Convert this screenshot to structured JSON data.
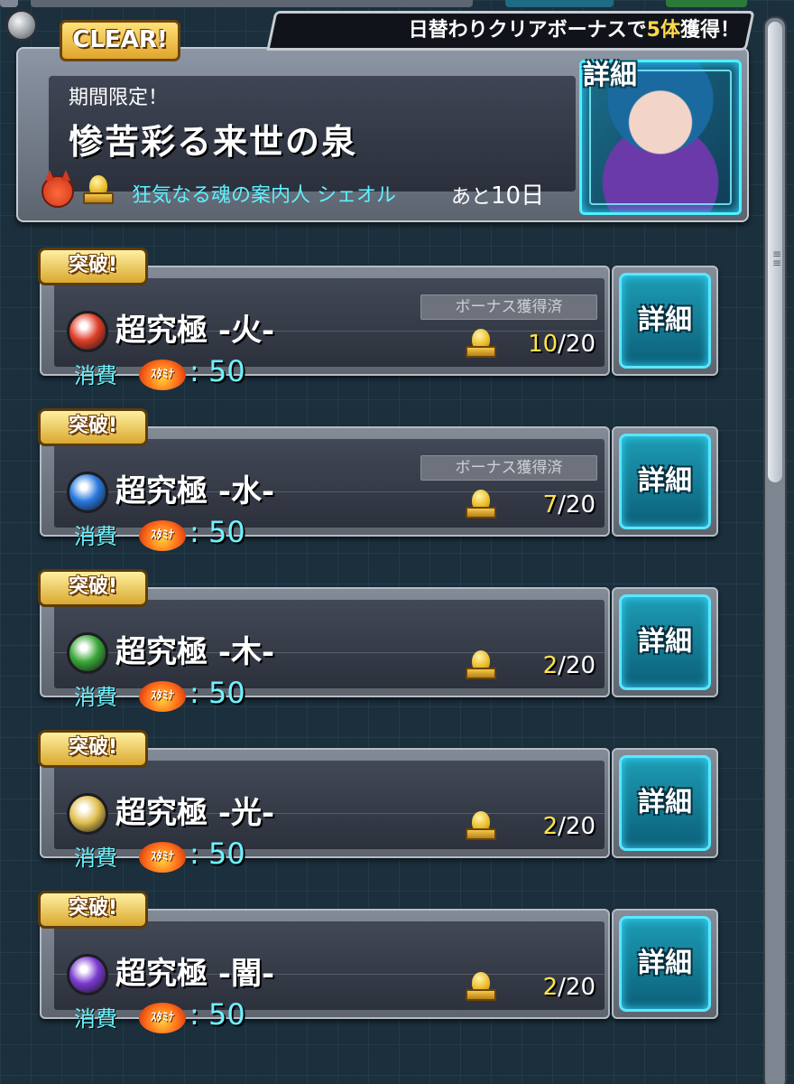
{
  "event": {
    "badge": "CLEAR!",
    "bonus_prefix": "日替わりクリアボーナスで",
    "bonus_count": "5体",
    "bonus_suffix": "獲得！",
    "subtitle": "期間限定！",
    "title": "惨苦彩る来世の泉",
    "guide": "狂気なる魂の案内人 シェオル",
    "remaining_prefix": "あと",
    "remaining_value": "10日",
    "detail_label": "詳細"
  },
  "quests": [
    {
      "breakthrough": "突破!",
      "title": "超究極 -火-",
      "element": "fire",
      "element_color": "#e0402a",
      "bonus_status": "ボーナス獲得済",
      "count_current": "10",
      "count_total": "/20",
      "cost_label": "消費",
      "stamina_label": "ｽﾀﾐﾅ",
      "stamina_value": ": 50",
      "detail_label": "詳細"
    },
    {
      "breakthrough": "突破!",
      "title": "超究極 -水-",
      "element": "water",
      "element_color": "#2a7ae0",
      "bonus_status": "ボーナス獲得済",
      "count_current": "7",
      "count_total": "/20",
      "cost_label": "消費",
      "stamina_label": "ｽﾀﾐﾅ",
      "stamina_value": ": 50",
      "detail_label": "詳細"
    },
    {
      "breakthrough": "突破!",
      "title": "超究極 -木-",
      "element": "wood",
      "element_color": "#3aa83a",
      "bonus_status": "",
      "count_current": "2",
      "count_total": "/20",
      "cost_label": "消費",
      "stamina_label": "ｽﾀﾐﾅ",
      "stamina_value": ": 50",
      "detail_label": "詳細"
    },
    {
      "breakthrough": "突破!",
      "title": "超究極 -光-",
      "element": "light",
      "element_color": "#e0c050",
      "bonus_status": "",
      "count_current": "2",
      "count_total": "/20",
      "cost_label": "消費",
      "stamina_label": "ｽﾀﾐﾅ",
      "stamina_value": ": 50",
      "detail_label": "詳細"
    },
    {
      "breakthrough": "突破!",
      "title": "超究極 -闇-",
      "element": "dark",
      "element_color": "#7a3ad0",
      "bonus_status": "",
      "count_current": "2",
      "count_total": "/20",
      "cost_label": "消費",
      "stamina_label": "ｽﾀﾐﾅ",
      "stamina_value": ": 50",
      "detail_label": "詳細"
    }
  ],
  "colors": {
    "accent_cyan": "#5ff0ff",
    "count_yellow": "#ffe34a",
    "badge_gold": "#e0a52a"
  }
}
